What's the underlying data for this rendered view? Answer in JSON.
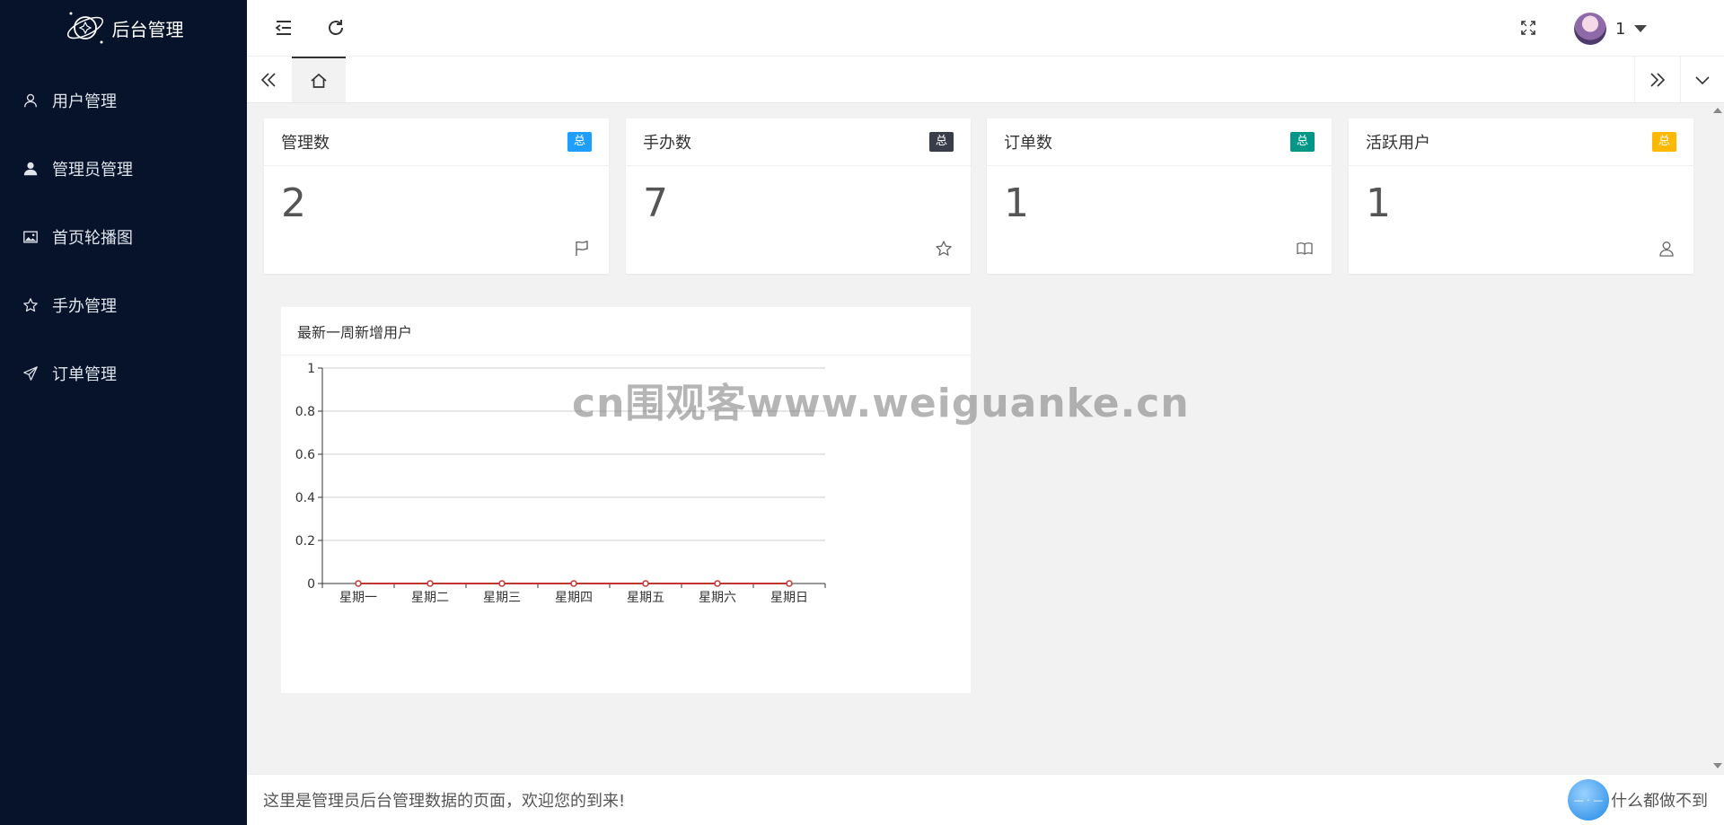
{
  "app": {
    "title": "后台管理"
  },
  "sidebar": {
    "items": [
      {
        "label": "用户管理",
        "icon": "user-icon"
      },
      {
        "label": "管理员管理",
        "icon": "admin-icon"
      },
      {
        "label": "首页轮播图",
        "icon": "image-icon"
      },
      {
        "label": "手办管理",
        "icon": "star-icon"
      },
      {
        "label": "订单管理",
        "icon": "send-icon"
      }
    ]
  },
  "header": {
    "user_name": "1"
  },
  "stats": [
    {
      "title": "管理数",
      "badge": "总",
      "badge_color": "#1e9fff",
      "value": "2",
      "icon": "flag-icon"
    },
    {
      "title": "手办数",
      "badge": "总",
      "badge_color": "#393d49",
      "value": "7",
      "icon": "star-icon"
    },
    {
      "title": "订单数",
      "badge": "总",
      "badge_color": "#009688",
      "value": "1",
      "icon": "book-icon"
    },
    {
      "title": "活跃用户",
      "badge": "总",
      "badge_color": "#ffb800",
      "value": "1",
      "icon": "user-icon"
    }
  ],
  "chart": {
    "title": "最新一周新增用户"
  },
  "chart_data": {
    "type": "line",
    "categories": [
      "星期一",
      "星期二",
      "星期三",
      "星期四",
      "星期五",
      "星期六",
      "星期日"
    ],
    "values": [
      0,
      0,
      0,
      0,
      0,
      0,
      0
    ],
    "ylim": [
      0,
      1
    ],
    "yticks": [
      "0",
      "0.2",
      "0.4",
      "0.6",
      "0.8",
      "1"
    ],
    "grid": true,
    "line_color": "#c23531"
  },
  "watermark": "cn围观客www.weiguanke.cn",
  "footer": {
    "left_text": "这里是管理员后台管理数据的页面，欢迎您的到来!",
    "right_text": "什么都做不到"
  }
}
